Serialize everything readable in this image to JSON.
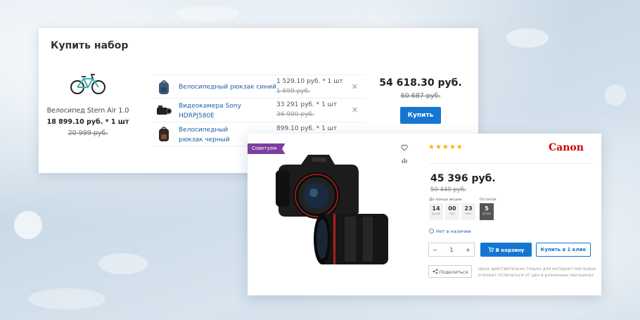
{
  "bundle": {
    "title": "Купить набор",
    "main_product": {
      "name": "Велосипед Stern Air 1.0",
      "price": "18 899.10 руб. * 1 шт",
      "old_price": "20 999 руб.",
      "icon": "bicycle-icon"
    },
    "items": [
      {
        "name": "Велосипедный рюкзак синий",
        "price": "1 529.10 руб. * 1 шт",
        "old_price": "1 699 руб.",
        "icon": "backpack-icon"
      },
      {
        "name": "Видеокамера Sony HDRPJ580E",
        "price": "33 291 руб. * 1 шт",
        "old_price": "36 990 руб.",
        "icon": "video-camera-icon"
      },
      {
        "name": "Велосипедный рюкзак черный",
        "price": "899.10 руб. * 1 шт",
        "old_price": "",
        "icon": "backpack-icon"
      }
    ],
    "remove_symbol": "✕",
    "total": "54 618.30 руб.",
    "total_old": "60 687 руб.",
    "buy_label": "Купить"
  },
  "product": {
    "badge": "Советуем",
    "rating_stars": "★★★★★",
    "brand": "Canon",
    "price": "45 396 руб.",
    "old_price": "50 440 руб.",
    "timer": {
      "label": "До конца акции",
      "days": "14",
      "days_unit": "дней",
      "hours": "00",
      "hours_unit": "час",
      "minutes": "23",
      "minutes_unit": "мин"
    },
    "stock": {
      "label": "Остаток",
      "value": "5",
      "unit": "штук"
    },
    "availability": "Нет в наличии",
    "quantity": "1",
    "qty_minus": "−",
    "qty_plus": "+",
    "cart_label": "В корзину",
    "one_click_label": "Купить в 1 клик",
    "share_label": "Поделиться",
    "note": "Цена действительна только для интернет-магазина и может отличаться от цен в розничных магазинах"
  },
  "colors": {
    "accent": "#1576d2",
    "badge": "#7b3fa0",
    "brand": "#cc0000",
    "stars": "#f4b400",
    "link": "#1d5fa8"
  }
}
